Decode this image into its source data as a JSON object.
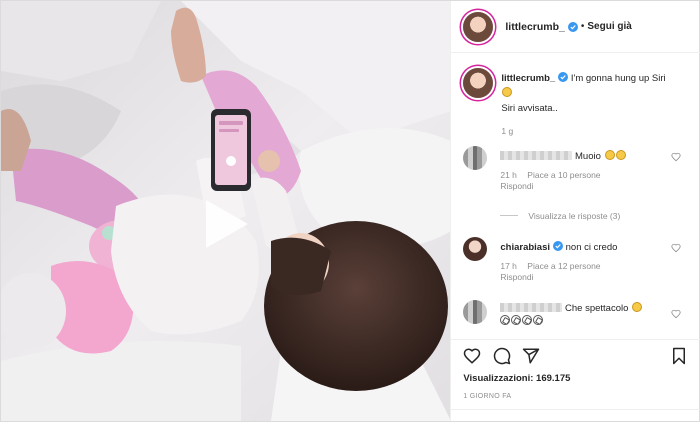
{
  "header": {
    "username": "littlecrumb_",
    "separator": "•",
    "follow_label": "Segui già"
  },
  "caption": {
    "username": "littlecrumb_",
    "text": "I'm gonna hung up Siri",
    "line2": "Siri avvisata..",
    "time": "1 g"
  },
  "comments": [
    {
      "text": "Muoio",
      "time": "21 h",
      "likes": "Piace a 10 persone",
      "reply": "Rispondi",
      "view_replies": "Visualizza le risposte (3)"
    },
    {
      "username": "chiarabiasi",
      "text": "non ci credo",
      "time": "17 h",
      "likes": "Piace a 12 persone",
      "reply": "Rispondi"
    },
    {
      "text": "Che spettacolo"
    }
  ],
  "stats": {
    "views_label": "Visualizzazioni:",
    "views_count": "169.175",
    "time_ago": "1 GIORNO FA"
  },
  "icons": {
    "like": "heart-icon",
    "comment": "comment-icon",
    "share": "share-icon",
    "save": "bookmark-icon",
    "play": "play-icon",
    "verified": "verified-badge-icon"
  },
  "colors": {
    "verified": "#3897f0",
    "text": "#262626",
    "muted": "#8e8e8e",
    "border": "#dbdbdb"
  }
}
